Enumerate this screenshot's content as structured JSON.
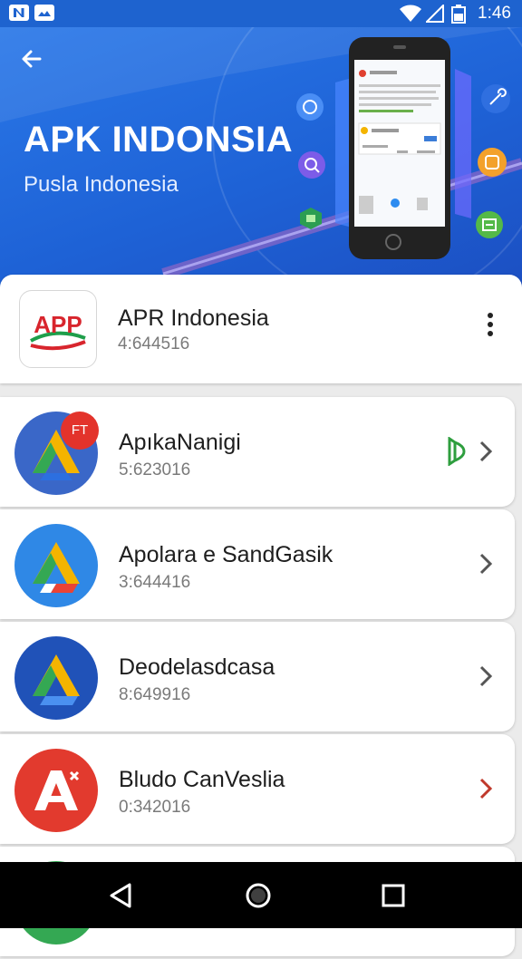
{
  "status_bar": {
    "time": "1:46",
    "left_icons": [
      "n-notification-icon",
      "image-notification-icon"
    ],
    "right_icons": [
      "wifi-icon",
      "signal-icon",
      "battery-icon"
    ]
  },
  "hero": {
    "title": "APK INDONSIA",
    "subtitle": "Pusla Indonesia",
    "back_icon": "back-arrow-icon",
    "colors": {
      "bg_start": "#2a78e8",
      "bg_end": "#1c4fc2"
    }
  },
  "featured": {
    "name": "APR Indonesia",
    "meta": "4:644516",
    "logo_text": "APP",
    "menu_icon": "more-vertical-icon"
  },
  "apps": [
    {
      "name": "ApıkaNanigi",
      "meta": "5:623016",
      "icon": "drive-a-icon",
      "icon_bg": "#3a67c8",
      "badge": "FT",
      "extra_icon": "green-d-icon",
      "chevron_color": "#555555"
    },
    {
      "name": "Apolara e SandGasik",
      "meta": "3:644416",
      "icon": "drive-a-icon",
      "icon_bg": "#2f88e6",
      "chevron_color": "#555555"
    },
    {
      "name": "Deodelasdcasa",
      "meta": "8:649916",
      "icon": "drive-a-icon",
      "icon_bg": "#2052b8",
      "chevron_color": "#555555"
    },
    {
      "name": "Bludo CanVeslia",
      "meta": "0:342016",
      "icon": "star-a-icon",
      "icon_bg": "#e23a2e",
      "chevron_color": "#c0392b"
    }
  ],
  "nav": {
    "back": "nav-back-icon",
    "home": "nav-home-icon",
    "recents": "nav-recents-icon"
  }
}
